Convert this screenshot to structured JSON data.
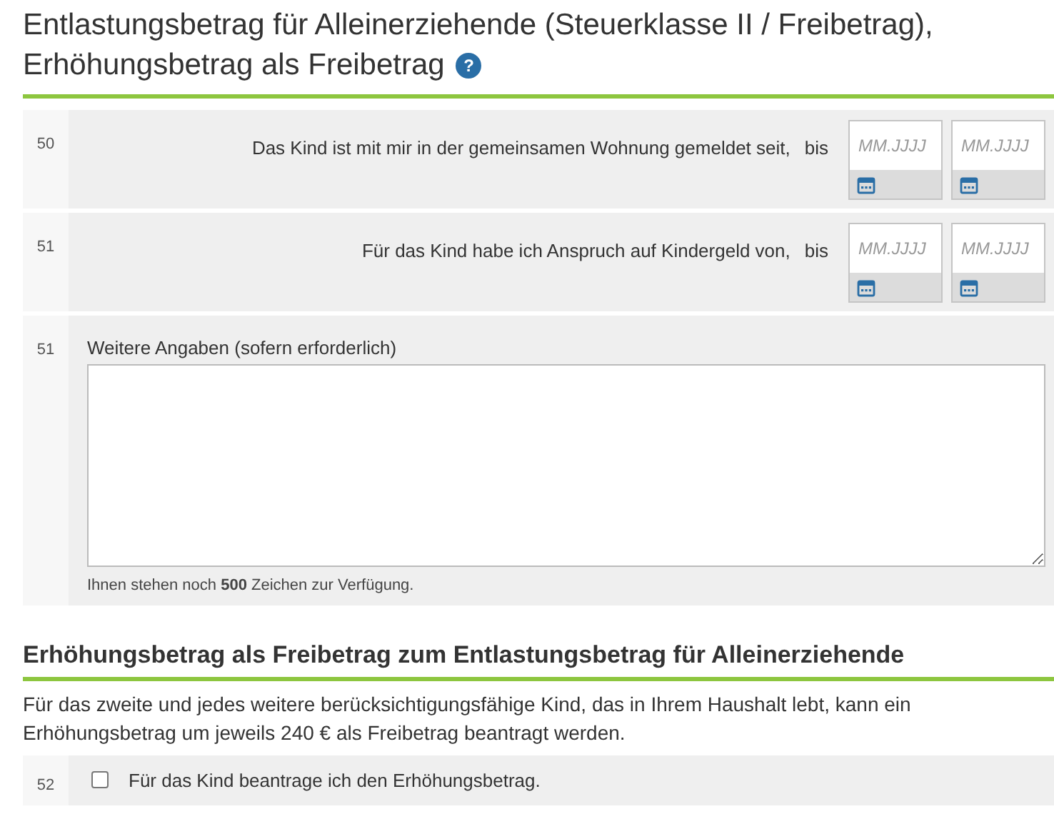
{
  "heading": {
    "title": "Entlastungsbetrag für Alleinerziehende (Steuerklasse II / Freibetrag), Erhöhungsbetrag als Freibetrag",
    "help": "?"
  },
  "rows": [
    {
      "kind": "date_range",
      "number": "50",
      "label": "Das Kind ist mit mir in der gemeinsamen Wohnung gemeldet seit,",
      "separator": "bis",
      "fields": [
        {
          "placeholder": "MM.JJJJ"
        },
        {
          "placeholder": "MM.JJJJ"
        }
      ]
    },
    {
      "kind": "date_range",
      "number": "51",
      "label": "Für das Kind habe ich Anspruch auf Kindergeld von,",
      "separator": "bis",
      "fields": [
        {
          "placeholder": "MM.JJJJ"
        },
        {
          "placeholder": "MM.JJJJ"
        }
      ]
    },
    {
      "kind": "textarea",
      "number": "51",
      "label": "Weitere Angaben (sofern erforderlich)",
      "hint": "Ihnen stehen noch **500** Zeichen zur Verfügung."
    }
  ],
  "section": {
    "title": "Erhöhungsbetrag als Freibetrag zum Entlastungsbetrag für Alleinerziehende",
    "text": "Für das zweite und jedes weitere berücksichtigungsfähige Kind, das in Ihrem Haushalt lebt, kann ein Erhöhungsbetrag um jeweils 240 € als Freibetrag beantragt werden.",
    "rows": [
      {
        "kind": "checkbox",
        "number": "52",
        "label": "Für das Kind beantrage ich den Erhöhungsbetrag.",
        "checked": false
      }
    ]
  }
}
